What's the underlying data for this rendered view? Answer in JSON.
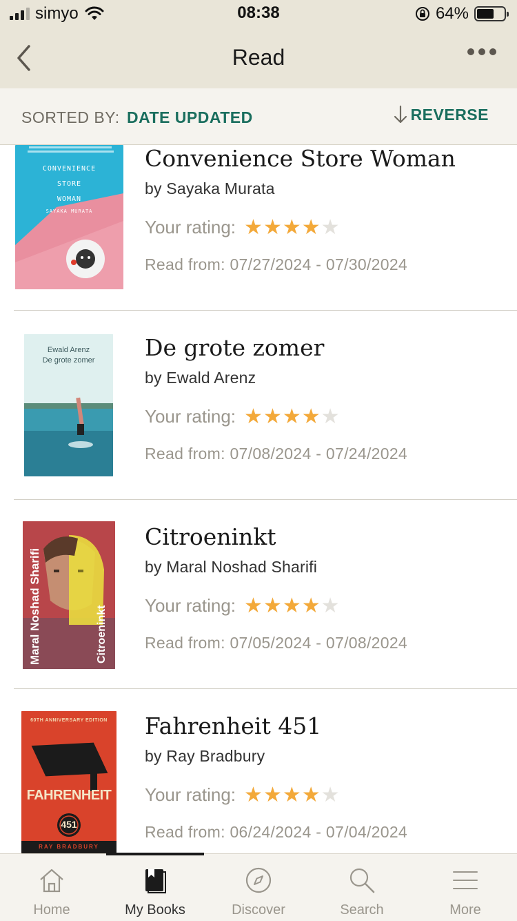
{
  "status_bar": {
    "carrier": "simyo",
    "time": "08:38",
    "battery_percent": "64%",
    "battery_level": 0.64
  },
  "nav": {
    "title": "Read"
  },
  "sort": {
    "label": "SORTED BY:",
    "value": "DATE UPDATED",
    "reverse_label": "REVERSE"
  },
  "books": [
    {
      "title": "Convenience Store Woman",
      "author": "by Sayaka Murata",
      "rating_label": "Your rating:",
      "rating": 4,
      "max_rating": 5,
      "read_from": "Read from: 07/27/2024 - 07/30/2024",
      "cover_text": [
        "CONVENIENCE",
        "STORE",
        "WOMAN",
        "SAYAKA MURATA"
      ],
      "cover_color": "#2cb3d6"
    },
    {
      "title": "De grote zomer",
      "author": "by Ewald Arenz",
      "rating_label": "Your rating:",
      "rating": 4,
      "max_rating": 5,
      "read_from": "Read from: 07/08/2024 - 07/24/2024",
      "cover_text": [
        "Ewald Arenz",
        "De grote zomer"
      ],
      "cover_color": "#cfe6e6"
    },
    {
      "title": "Citroeninkt",
      "author": "by Maral Noshad Sharifi",
      "rating_label": "Your rating:",
      "rating": 4,
      "max_rating": 5,
      "read_from": "Read from: 07/05/2024 - 07/08/2024",
      "cover_text": [
        "Maral Noshad Sharifi",
        "Citroeninkt"
      ],
      "cover_color": "#b8464a"
    },
    {
      "title": "Fahrenheit 451",
      "author": "by Ray Bradbury",
      "rating_label": "Your rating:",
      "rating": 4,
      "max_rating": 5,
      "read_from": "Read from: 06/24/2024 - 07/04/2024",
      "cover_text": [
        "60TH ANNIVERSARY EDITION",
        "FAHRENHEIT",
        "451",
        "RAY BRADBURY"
      ],
      "cover_color": "#d9432b"
    }
  ],
  "tabs": [
    {
      "label": "Home",
      "icon": "home-icon",
      "active": false
    },
    {
      "label": "My Books",
      "icon": "my-books-icon",
      "active": true
    },
    {
      "label": "Discover",
      "icon": "compass-icon",
      "active": false
    },
    {
      "label": "Search",
      "icon": "search-icon",
      "active": false
    },
    {
      "label": "More",
      "icon": "menu-icon",
      "active": false
    }
  ]
}
